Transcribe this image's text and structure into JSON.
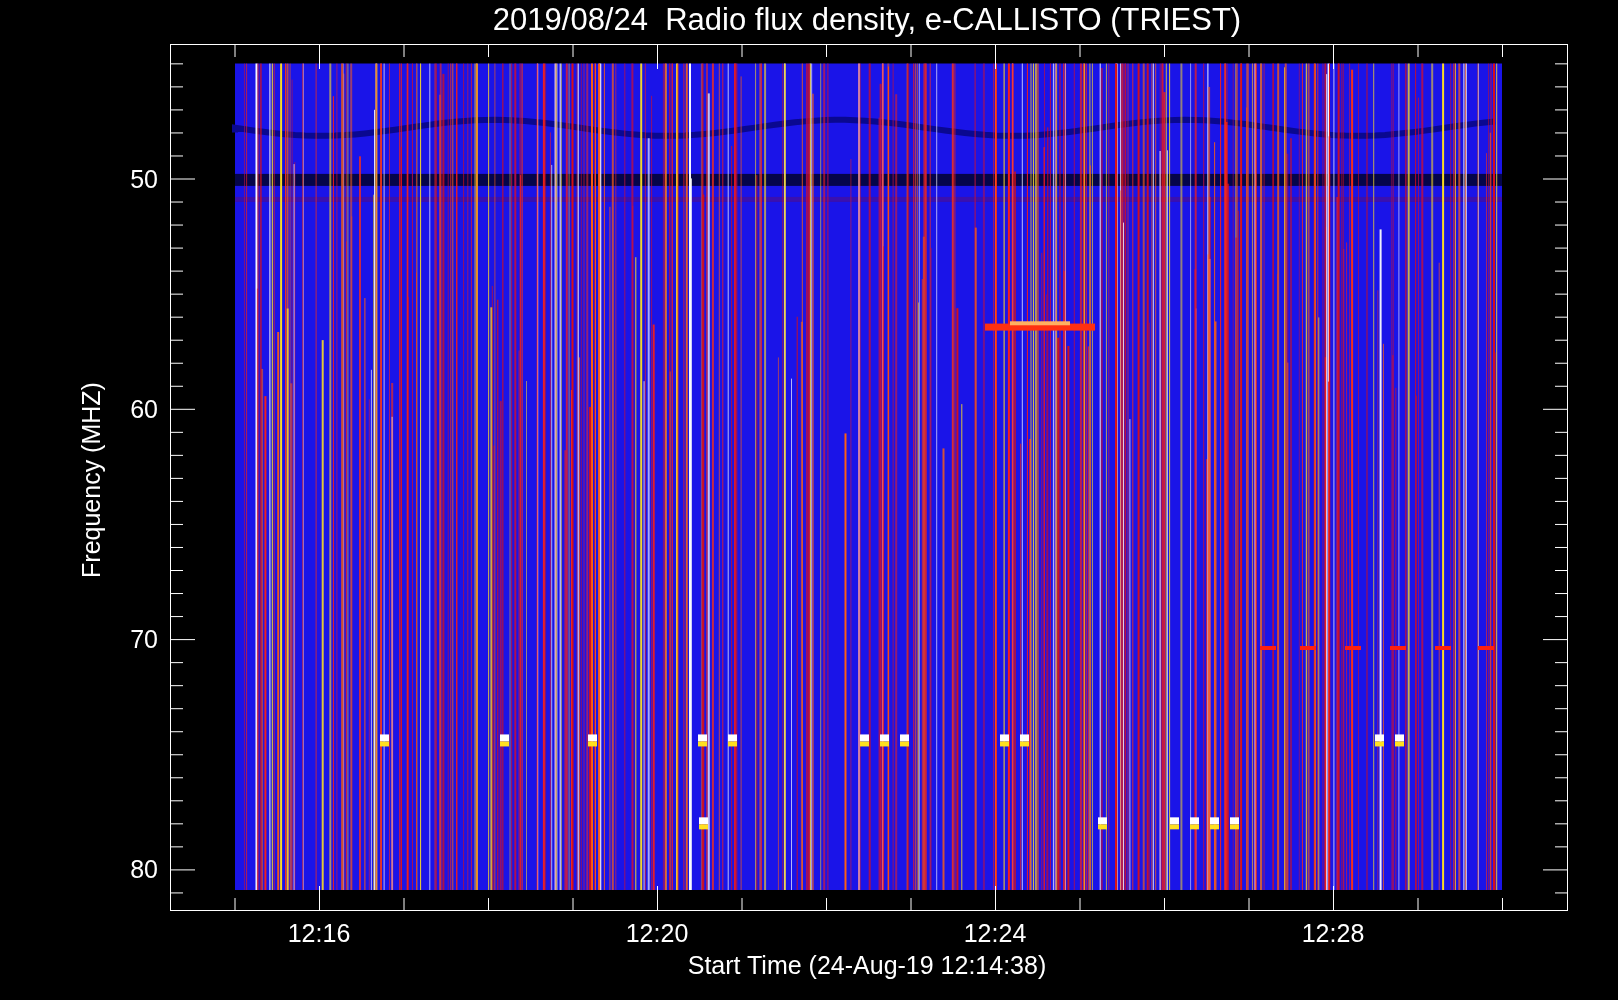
{
  "title": "2019/08/24  Radio flux density, e-CALLISTO (TRIEST)",
  "plot": {
    "ylabel": "Frequency (MHZ)",
    "xlabel": "Start Time (24-Aug-19 12:14:38)",
    "yticks": [
      "50",
      "60",
      "70",
      "80"
    ],
    "xticks": [
      "12:16",
      "12:20",
      "12:24",
      "12:28"
    ]
  }
}
